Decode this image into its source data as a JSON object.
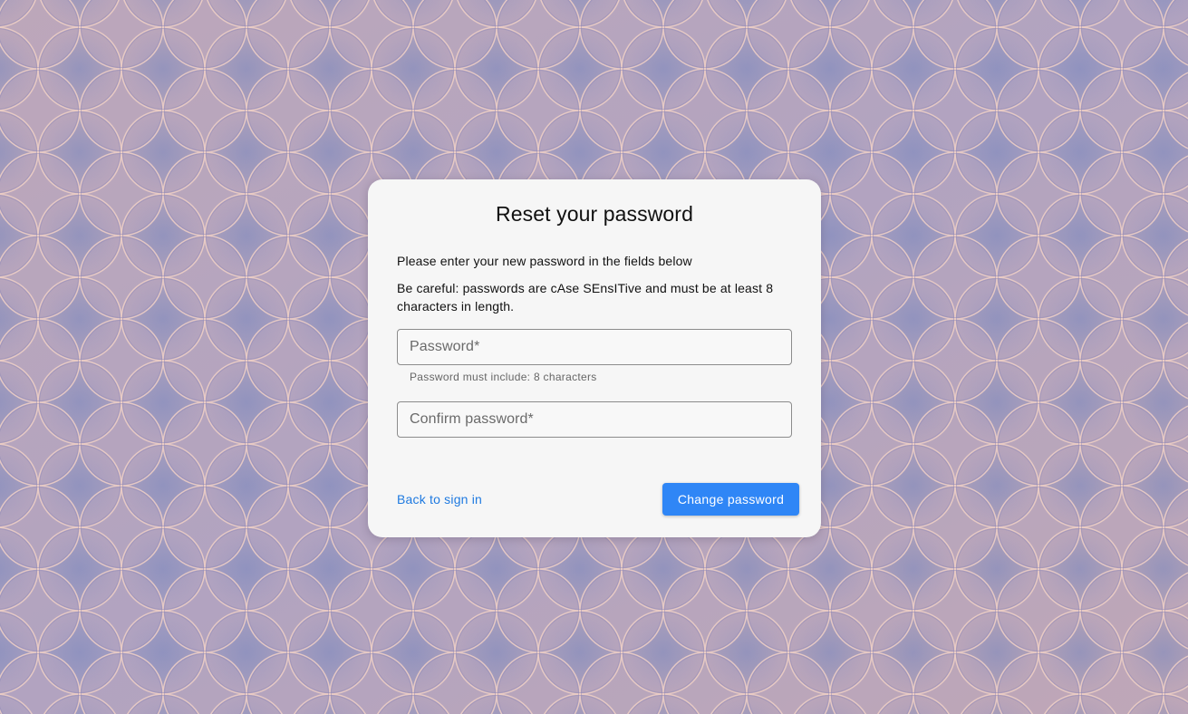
{
  "page": {
    "title": "Reset your password",
    "instruction": "Please enter your new password in the fields below",
    "warning": "Be careful: passwords are cAse SEnsITive and must be at least 8 characters in length."
  },
  "form": {
    "password": {
      "label": "Password",
      "required_marker": "*",
      "value": "",
      "helper": "Password must include: 8 characters"
    },
    "confirm": {
      "label": "Confirm password",
      "required_marker": "*",
      "value": ""
    }
  },
  "actions": {
    "back_label": "Back to sign in",
    "submit_label": "Change password"
  },
  "colors": {
    "accent": "#2f86f6",
    "link": "#1f7ae0",
    "card_background": "#f6f6f6",
    "background_blue": "#8e96c4",
    "background_peach": "#e7b3aa"
  }
}
